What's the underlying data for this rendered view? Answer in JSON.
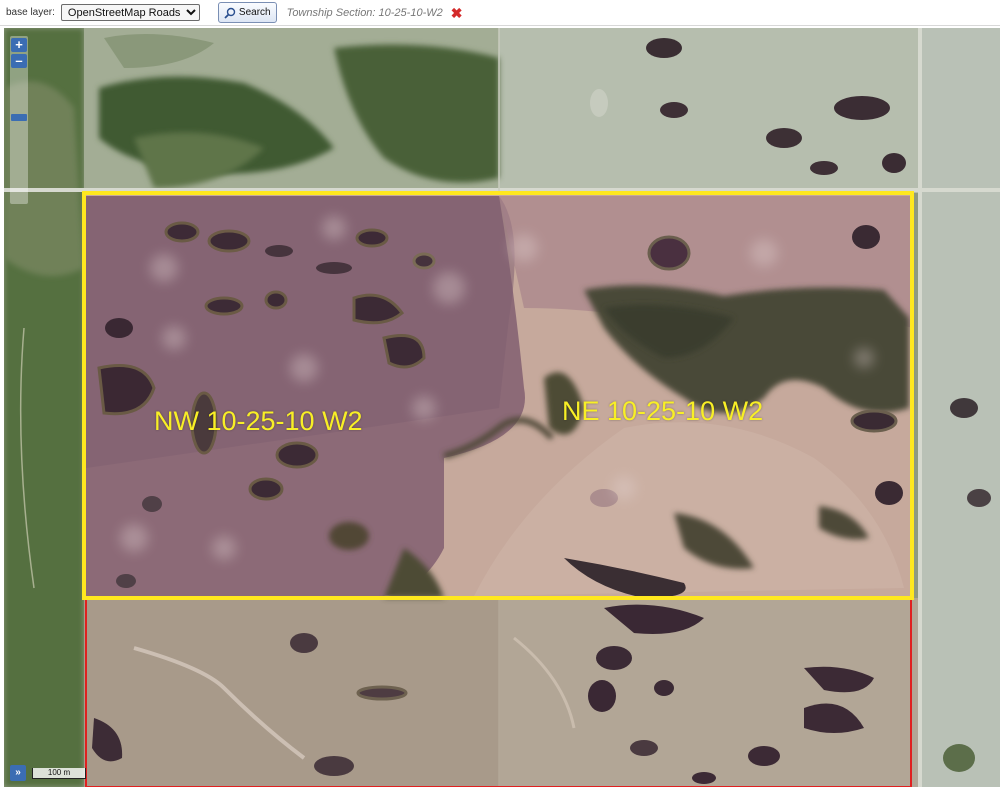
{
  "toolbar": {
    "base_layer_label": "base layer:",
    "base_layer_value": "OpenStreetMap Roads",
    "search_label": "Search",
    "section_text": "Township Section: 10-25-10-W2",
    "close_glyph": "✖"
  },
  "map": {
    "zoom_in": "+",
    "zoom_out": "–",
    "expand": "»",
    "scale_label": "100 m",
    "labels": {
      "nw": "NW 10-25-10 W2",
      "ne": "NE 10-25-10 W2"
    },
    "colors": {
      "highlight_outline": "#ffe81f",
      "adjacent_outline": "#e02020",
      "highlight_tint": "#7a3d6b",
      "label_text": "#f8ef26"
    }
  }
}
